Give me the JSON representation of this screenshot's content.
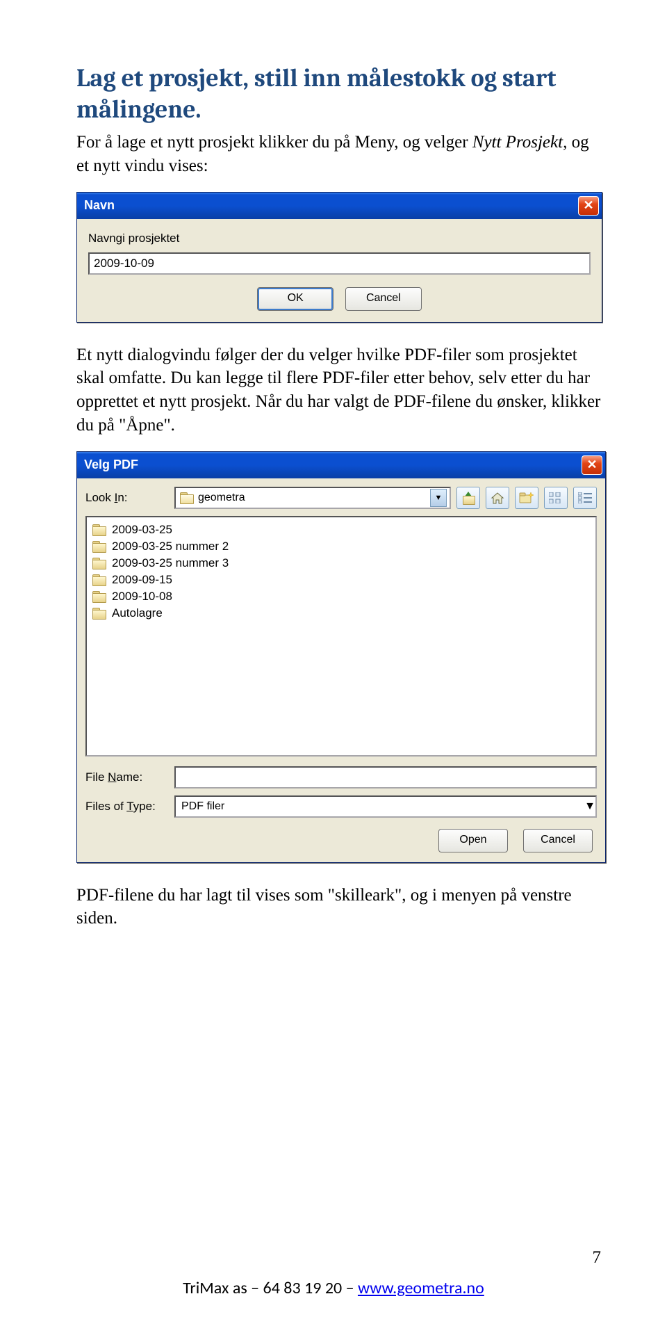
{
  "heading": "Lag et prosjekt, still inn målestokk og start målingene.",
  "intro_a": "For å lage et nytt prosjekt klikker du på Meny, og velger ",
  "intro_em": "Nytt Prosjekt,",
  "intro_b": " og et nytt vindu vises:",
  "dialog1": {
    "title": "Navn",
    "label": "Navngi prosjektet",
    "value": "2009-10-09",
    "ok": "OK",
    "cancel": "Cancel"
  },
  "para2": "Et nytt dialogvindu følger der du velger hvilke PDF-filer som prosjektet skal omfatte. Du kan legge til flere PDF-filer etter behov, selv etter du har opprettet et nytt prosjekt. Når du har valgt de PDF-filene du ønsker, klikker du på \"Åpne\".",
  "dialog2": {
    "title": "Velg PDF",
    "lookin_label": "Look In:",
    "lookin_value": "geometra",
    "items": [
      "2009-03-25",
      "2009-03-25 nummer 2",
      "2009-03-25 nummer 3",
      "2009-09-15",
      "2009-10-08",
      "Autolagre"
    ],
    "filename_label": "File Name:",
    "filename_value": "",
    "filetype_label": "Files of Type:",
    "filetype_value": "PDF filer",
    "open": "Open",
    "cancel": "Cancel"
  },
  "para3": "PDF-filene du har lagt til vises som \"skilleark\", og i menyen på venstre siden.",
  "page_number": "7",
  "footer": {
    "company": "TriMax as – 64 83 19 20 – ",
    "link": "www.geometra.no"
  }
}
